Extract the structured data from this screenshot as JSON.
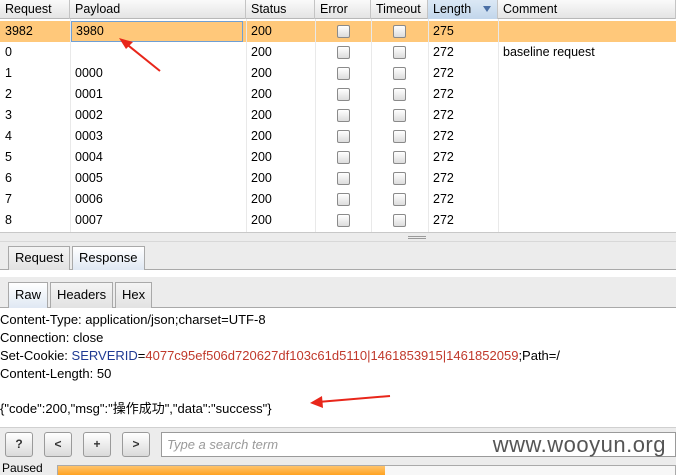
{
  "table": {
    "columns": [
      "Request",
      "Payload",
      "Status",
      "Error",
      "Timeout",
      "Length",
      "Comment"
    ],
    "rows": [
      {
        "request": "3982",
        "payload": "3980",
        "status": "200",
        "length": "275",
        "comment": "",
        "selected": true
      },
      {
        "request": "0",
        "payload": "",
        "status": "200",
        "length": "272",
        "comment": "baseline request"
      },
      {
        "request": "1",
        "payload": "0000",
        "status": "200",
        "length": "272",
        "comment": ""
      },
      {
        "request": "2",
        "payload": "0001",
        "status": "200",
        "length": "272",
        "comment": ""
      },
      {
        "request": "3",
        "payload": "0002",
        "status": "200",
        "length": "272",
        "comment": ""
      },
      {
        "request": "4",
        "payload": "0003",
        "status": "200",
        "length": "272",
        "comment": ""
      },
      {
        "request": "5",
        "payload": "0004",
        "status": "200",
        "length": "272",
        "comment": ""
      },
      {
        "request": "6",
        "payload": "0005",
        "status": "200",
        "length": "272",
        "comment": ""
      },
      {
        "request": "7",
        "payload": "0006",
        "status": "200",
        "length": "272",
        "comment": ""
      },
      {
        "request": "8",
        "payload": "0007",
        "status": "200",
        "length": "272",
        "comment": ""
      }
    ]
  },
  "tabs_main": [
    "Request",
    "Response"
  ],
  "tabs_view": [
    "Raw",
    "Headers",
    "Hex"
  ],
  "response": {
    "content_type": "Content-Type: application/json;charset=UTF-8",
    "connection": "Connection: close",
    "set_cookie_prefix": "Set-Cookie: ",
    "cookie_name": "SERVERID",
    "cookie_eq": "=",
    "cookie_value": "4077c95ef506d720627df103c61d5110|1461853915|1461852059",
    "cookie_suffix": ";Path=/",
    "content_length": "Content-Length: 50",
    "body": "{\"code\":200,\"msg\":\"操作成功\",\"data\":\"success\"}"
  },
  "toolbar": {
    "help_label": "?",
    "prev_label": "<",
    "add_label": "+",
    "next_label": ">",
    "search_placeholder": "Type a search term"
  },
  "watermark": "www.wooyun.org",
  "progress": {
    "label": "Paused",
    "fraction": 0.53
  },
  "colors": {
    "selected_row": "#ffc87a",
    "arrow": "#e8261a",
    "progress": "#ff9f1a"
  }
}
